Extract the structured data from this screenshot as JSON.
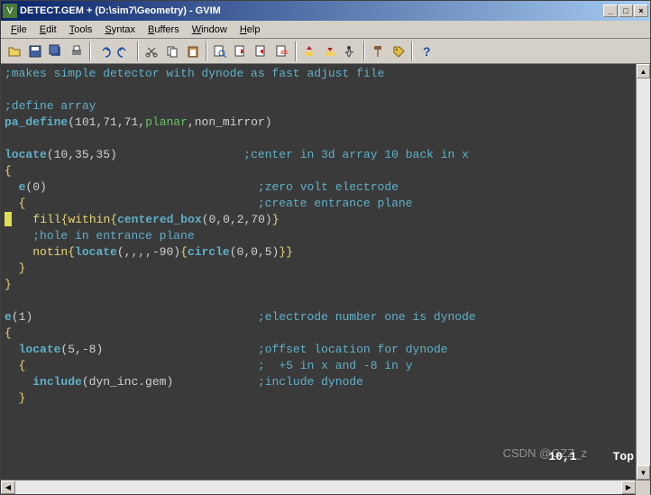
{
  "title": "DETECT.GEM + (D:\\sim7\\Geometry) - GVIM",
  "menu": {
    "file": "File",
    "edit": "Edit",
    "tools": "Tools",
    "syntax": "Syntax",
    "buffers": "Buffers",
    "window": "Window",
    "help": "Help"
  },
  "win_btns": {
    "min": "_",
    "max": "□",
    "close": "×"
  },
  "code": {
    "l1_comment": ";makes simple detector with dynode as fast adjust file",
    "l3_comment": ";define array",
    "l4_fn": "pa_define",
    "l4_args1": "101",
    "l4_args2": "71",
    "l4_args3": "71",
    "l4_id1": "planar",
    "l4_id2": "non_mirror",
    "l6_fn": "locate",
    "l6_args": "10,35,35",
    "l6_comment": ";center in 3d array 10 back in x",
    "l8_fn": "e",
    "l8_arg": "0",
    "l8_comment": ";zero volt electrode",
    "l9_comment": ";create entrance plane",
    "l10_fn1": "fill",
    "l10_fn2": "within",
    "l10_fn3": "centered_box",
    "l10_args": "0,0,2,70",
    "l11_comment": ";hole in entrance plane",
    "l12_fn1": "notin",
    "l12_fn2": "locate",
    "l12_args1": ",,,,-90",
    "l12_fn3": "circle",
    "l12_args2": "0,0,5",
    "l16_fn": "e",
    "l16_arg": "1",
    "l16_comment": ";electrode number one is dynode",
    "l18_fn": "locate",
    "l18_args": "5,-8",
    "l18_comment": ";offset location for dynode",
    "l19_comment": ";  +5 in x and -8 in y",
    "l20_fn": "include",
    "l20_arg": "dyn_inc.gem",
    "l20_comment": ";include dynode"
  },
  "status": {
    "pos": "10,1",
    "loc": "Top"
  },
  "watermark": "CSDN @GZZ_z"
}
